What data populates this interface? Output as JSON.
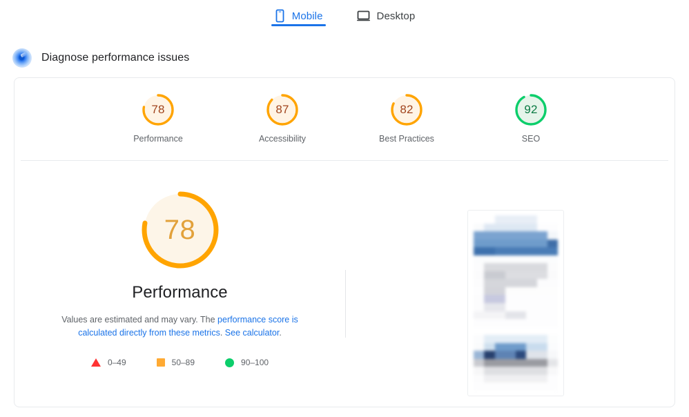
{
  "tabs": [
    {
      "id": "mobile",
      "label": "Mobile",
      "icon": "mobile-phone-icon",
      "active": true
    },
    {
      "id": "desktop",
      "label": "Desktop",
      "icon": "desktop-monitor-icon",
      "active": false
    }
  ],
  "diagnose": {
    "icon": "lighthouse-icon",
    "title": "Diagnose performance issues"
  },
  "category_scores": [
    {
      "id": "performance",
      "label": "Performance",
      "score": 78,
      "color": "#ffa400",
      "track": "#fff4e5",
      "text_color": "#a1441d"
    },
    {
      "id": "accessibility",
      "label": "Accessibility",
      "score": 87,
      "color": "#ffa400",
      "track": "#fff4e5",
      "text_color": "#a1441d"
    },
    {
      "id": "best-practices",
      "label": "Best Practices",
      "score": 82,
      "color": "#ffa400",
      "track": "#fff4e5",
      "text_color": "#a1441d"
    },
    {
      "id": "seo",
      "label": "SEO",
      "score": 92,
      "color": "#0cce6b",
      "track": "#e6f4ea",
      "text_color": "#0b7a43"
    }
  ],
  "primary": {
    "score": 78,
    "title": "Performance",
    "score_color": "#ffa400",
    "track_color": "#fdf5e8",
    "description_part1": "Values are estimated and may vary. The ",
    "link1": "performance score is calculated directly from these metrics",
    "description_part2": ". ",
    "link2": "See calculator",
    "description_part3": "."
  },
  "legend": [
    {
      "shape": "triangle",
      "color": "#ff3333",
      "range": "0–49"
    },
    {
      "shape": "square",
      "color": "#ffaa33",
      "range": "50–89"
    },
    {
      "shape": "circle",
      "color": "#0cce6b",
      "range": "90–100"
    }
  ],
  "thumbnail": {
    "name": "page-screenshot-thumbnail",
    "alt": "Blurred screenshot of the analyzed mobile page"
  }
}
